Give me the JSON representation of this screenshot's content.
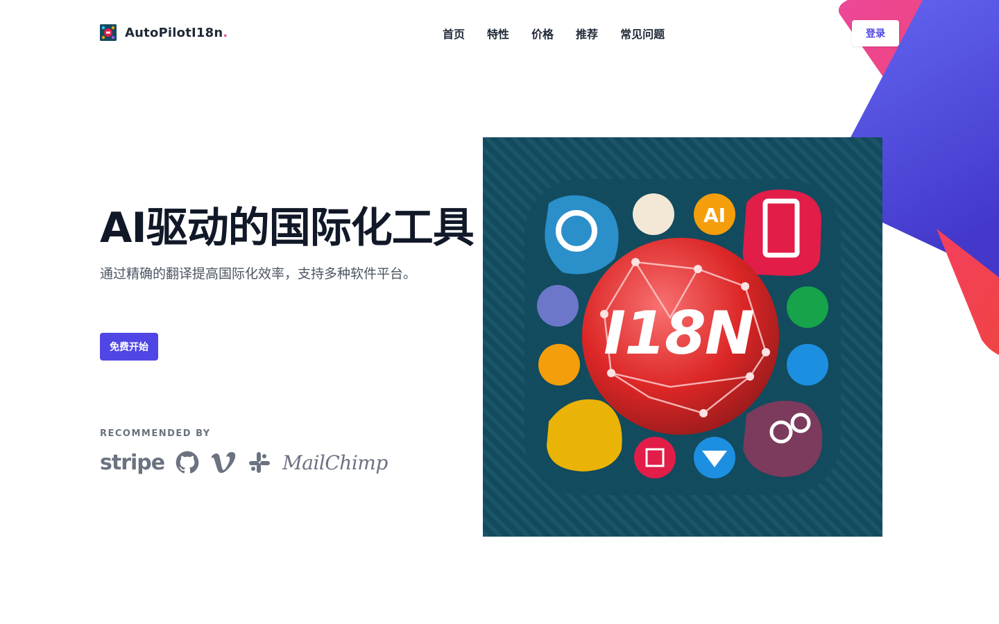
{
  "brand": {
    "name": "AutoPilotI18n",
    "dot": ".",
    "logo_icon": "autopilot-logo-icon"
  },
  "nav": {
    "items": [
      {
        "label": "首页"
      },
      {
        "label": "特性"
      },
      {
        "label": "价格"
      },
      {
        "label": "推荐"
      },
      {
        "label": "常见问题"
      }
    ],
    "login_label": "登录"
  },
  "hero": {
    "title": "AI驱动的国际化工具",
    "subtitle": "通过精确的翻译提高国际化效率，支持多种软件平台。",
    "cta_label": "免费开始",
    "image_label": "I18N"
  },
  "recommended": {
    "label": "RECOMMENDED BY",
    "logos": [
      {
        "name": "stripe",
        "text": "stripe"
      },
      {
        "name": "github-icon"
      },
      {
        "name": "vimeo-icon"
      },
      {
        "name": "slack-icon"
      },
      {
        "name": "mailchimp",
        "text": "MailChimp"
      }
    ]
  },
  "colors": {
    "accent": "#4f46e5",
    "brand_dot": "#ec4899",
    "text_dark": "#111827",
    "text_muted": "#6b7280",
    "image_bg": "#134a5e",
    "globe_red": "#e11d48"
  }
}
